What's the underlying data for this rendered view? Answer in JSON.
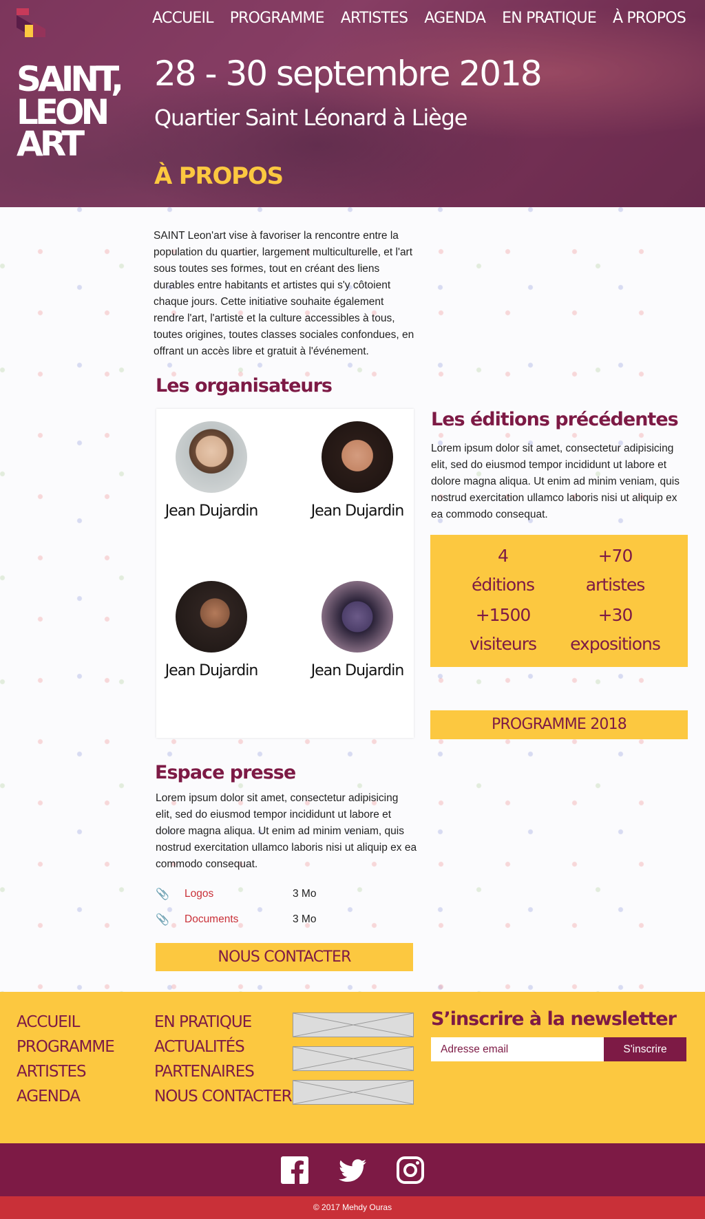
{
  "nav": {
    "items": [
      {
        "label": "ACCUEIL"
      },
      {
        "label": "PROGRAMME"
      },
      {
        "label": "ARTISTES"
      },
      {
        "label": "AGENDA"
      },
      {
        "label": "EN PRATIQUE"
      },
      {
        "label": "À PROPOS"
      }
    ]
  },
  "hero": {
    "logo_text": [
      "SAINT,",
      "LEON",
      "ART"
    ],
    "date": "28 - 30 septembre 2018",
    "place": "Quartier Saint Léonard à Liège",
    "section": "À PROPOS"
  },
  "intro": "SAINT Leon'art vise à favoriser la rencontre entre la population du quartier, largement multiculturelle, et l'art sous toutes ses formes, tout en créant des liens durables entre habitants et artistes qui s'y côtoient chaque jours. Cette initiative souhaite également rendre l'art, l'artiste et la culture accessibles à tous, toutes origines, toutes classes sociales confondues, en offrant un accès libre et gratuit à l'événement.",
  "organizers": {
    "title_highlight": "Les",
    "title_rest": " organisateurs",
    "people": [
      {
        "name": "Jean Dujardin"
      },
      {
        "name": "Jean Dujardin"
      },
      {
        "name": "Jean Dujardin"
      },
      {
        "name": "Jean Dujardin"
      }
    ]
  },
  "editions": {
    "title": "Les éditions précédentes",
    "text": "Lorem ipsum dolor sit amet, consectetur adipisicing elit, sed do eiusmod tempor incididunt ut labore et dolore magna aliqua. Ut enim ad minim veniam, quis nostrud exercitation ullamco laboris nisi ut aliquip ex ea commodo consequat.",
    "stats": [
      {
        "value": "4",
        "label": "éditions"
      },
      {
        "value": "+70",
        "label": "artistes"
      },
      {
        "value": "+1500",
        "label": "visiteurs"
      },
      {
        "value": "+30",
        "label": "expositions"
      }
    ],
    "button": "PROGRAMME 2018"
  },
  "press": {
    "title": "Espace presse",
    "text": "Lorem ipsum dolor sit amet, consectetur adipisicing elit, sed do eiusmod tempor incididunt ut labore et dolore magna aliqua. Ut enim ad minim veniam, quis nostrud exercitation ullamco laboris nisi ut aliquip ex ea commodo consequat.",
    "files": [
      {
        "name": "Logos",
        "size": "3 Mo"
      },
      {
        "name": "Documents",
        "size": "3 Mo"
      }
    ],
    "contact_button": "NOUS CONTACTER"
  },
  "footer": {
    "col1": [
      "ACCUEIL",
      "PROGRAMME",
      "ARTISTES",
      "AGENDA"
    ],
    "col2": [
      "EN PRATIQUE",
      "ACTUALITÉS",
      "PARTENAIRES",
      "NOUS CONTACTER"
    ],
    "newsletter_title": "S’inscrire à la newsletter",
    "email_placeholder": "Adresse email",
    "subscribe": "S'inscrire"
  },
  "social": [
    "facebook-icon",
    "twitter-icon",
    "instagram-icon"
  ],
  "copyright": "© 2017 Mehdy Ouras",
  "colors": {
    "primary": "#7d1a45",
    "accent": "#fcc840",
    "red": "#c93038"
  }
}
